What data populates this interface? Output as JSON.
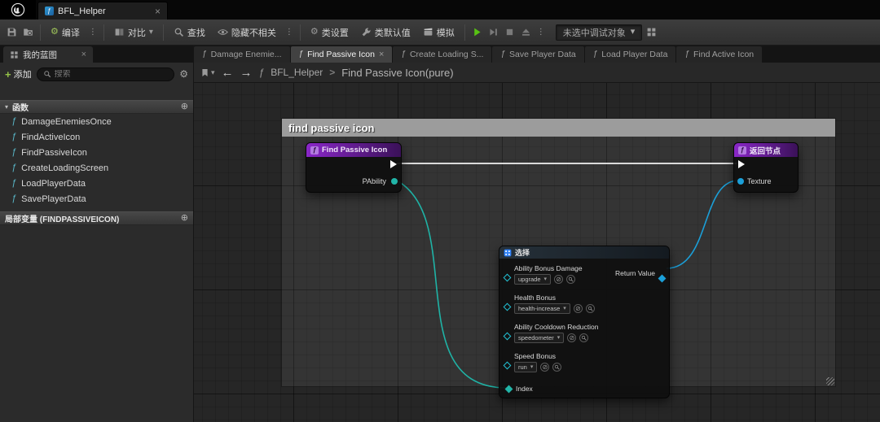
{
  "titlebar": {
    "asset_tab": "BFL_Helper"
  },
  "toolbar": {
    "compile": "编译",
    "diff": "对比",
    "find": "查找",
    "hide_unrelated": "隐藏不相关",
    "class_settings": "类设置",
    "class_defaults": "类默认值",
    "simulate": "模拟",
    "debug_object": "未选中调试对象"
  },
  "sidebar": {
    "panel_tab": "我的蓝图",
    "add": "添加",
    "search_placeholder": "搜索",
    "functions_header": "函数",
    "local_vars_header": "局部变量 (FINDPASSIVEICON)",
    "functions": [
      "DamageEnemiesOnce",
      "FindActiveIcon",
      "FindPassiveIcon",
      "CreateLoadingScreen",
      "LoadPlayerData",
      "SavePlayerData"
    ]
  },
  "doc_tabs": [
    {
      "label": "Damage Enemie..."
    },
    {
      "label": "Find Passive Icon"
    },
    {
      "label": "Create Loading S..."
    },
    {
      "label": "Save Player Data"
    },
    {
      "label": "Load Player Data"
    },
    {
      "label": "Find Active Icon"
    }
  ],
  "breadcrumb": {
    "root": "BFL_Helper",
    "current": "Find Passive Icon(pure)"
  },
  "graph": {
    "comment_title": "find passive icon",
    "entry_node": {
      "title": "Find Passive Icon",
      "pin": "PAbility"
    },
    "return_node": {
      "title": "返回节点",
      "pin": "Texture"
    },
    "select_node": {
      "title": "选择",
      "return_pin": "Return Value",
      "index_pin": "Index",
      "options": [
        {
          "label": "Ability Bonus Damage",
          "value": "upgrade"
        },
        {
          "label": "Health Bonus",
          "value": "health-increase"
        },
        {
          "label": "Ability Cooldown Reduction",
          "value": "speedometer"
        },
        {
          "label": "Speed Bonus",
          "value": "run"
        }
      ]
    }
  },
  "colors": {
    "exec_wire": "#f2f2f2",
    "object_wire": "#1b9fd8",
    "struct_wire": "#1fb3a6",
    "node_header_purple": "#8a27c8"
  }
}
